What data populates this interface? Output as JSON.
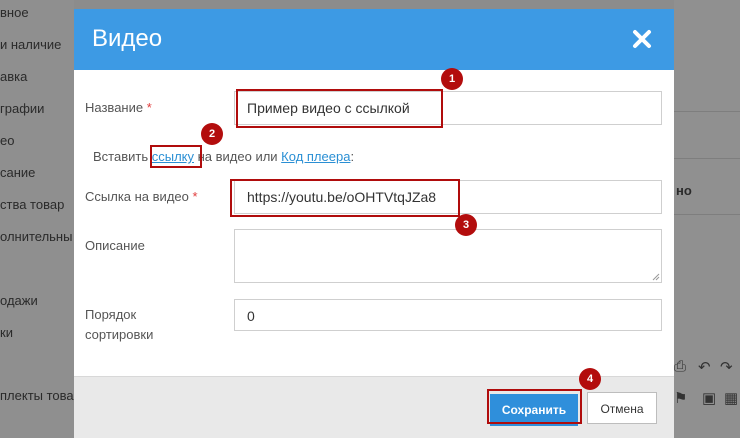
{
  "background": {
    "sidebar_items": [
      "вное",
      "и наличие",
      "авка",
      "графии",
      "ео",
      "сание",
      "ства товар",
      "олнительны",
      "одажи",
      "ки",
      "плекты товар"
    ],
    "right_text": "но"
  },
  "modal": {
    "title": "Видео",
    "fields": {
      "name": {
        "label": "Название",
        "required_mark": "*",
        "value": "Пример видео с ссылкой"
      },
      "hint": {
        "prefix": "Вставить ",
        "link1": "ссылку",
        "middle": " на видео или ",
        "link2": "Код плеера",
        "suffix": ":"
      },
      "video_url": {
        "label": "Ссылка на видео",
        "required_mark": "*",
        "value": "https://youtu.be/oOHTVtqJZa8"
      },
      "description": {
        "label": "Описание",
        "value": ""
      },
      "sort_order": {
        "label_line1": "Порядок",
        "label_line2": "сортировки",
        "value": "0"
      }
    },
    "buttons": {
      "save": "Сохранить",
      "cancel": "Отмена"
    }
  },
  "annotations": [
    "1",
    "2",
    "3",
    "4"
  ],
  "colors": {
    "header": "#3d9ae4",
    "save_button": "#2f8fdb",
    "annotation": "#b30d0d",
    "link": "#2a8fd4",
    "required": "#e03b3b"
  }
}
